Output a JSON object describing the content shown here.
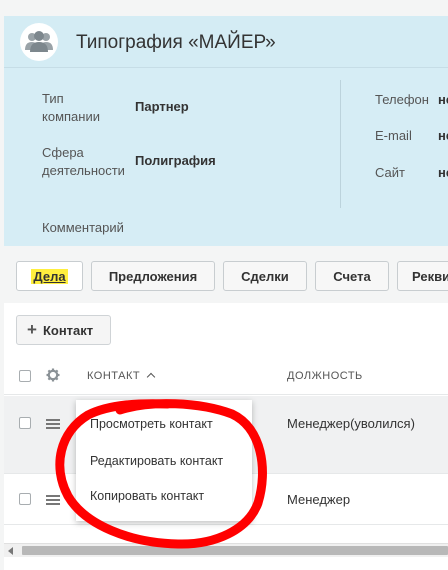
{
  "company": {
    "title": "Типография «МАЙЕР»",
    "icon": "people-group-icon"
  },
  "details": {
    "type_label": "Тип компании",
    "type_value": "Партнер",
    "sphere_label": "Сфера деятельности",
    "sphere_value": "Полиграфия",
    "comment_label": "Комментарий",
    "phone_label": "Телефон",
    "phone_value": "не",
    "email_label": "E-mail",
    "email_value": "не",
    "site_label": "Сайт",
    "site_value": "не"
  },
  "tabs": [
    {
      "label": "Дела",
      "active": true
    },
    {
      "label": "Предложения",
      "active": false
    },
    {
      "label": "Сделки",
      "active": false
    },
    {
      "label": "Счета",
      "active": false
    },
    {
      "label": "Рекви",
      "active": false
    }
  ],
  "toolbar": {
    "add_contact_label": "Контакт"
  },
  "table": {
    "columns": [
      "КОНТАКТ",
      "ДОЛЖНОСТЬ"
    ],
    "rows": [
      {
        "position": "Менеджер(уволился)"
      },
      {
        "position": "Менеджер"
      }
    ]
  },
  "context_menu": {
    "items": [
      "Просмотреть контакт",
      "Редактировать контакт",
      "Копировать контакт"
    ]
  },
  "colors": {
    "header_bg": "#d6edf5",
    "tab_highlight": "#ffef3e",
    "annotation": "#ff0000"
  }
}
